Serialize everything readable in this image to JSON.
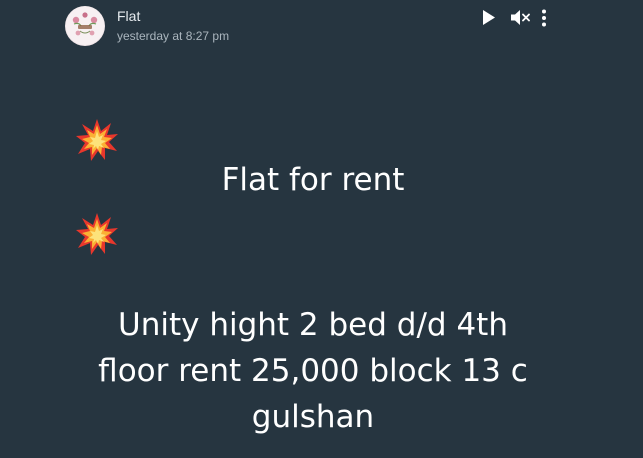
{
  "post": {
    "author": "Flat",
    "timestamp": "yesterday at 8:27 pm",
    "emoji_icon": "collision-emoji-icon",
    "headline": "Flat for rent",
    "body_lines": [
      "Unity hight 2 bed d/d 4th",
      "floor rent 25,000 block 13 c",
      "gulshan"
    ]
  },
  "controls": {
    "icons": [
      "play-icon",
      "mute-icon",
      "more-vertical-icon"
    ]
  },
  "colors": {
    "background": "#263540",
    "text": "#ffffff",
    "secondary_text": "#aab5bd"
  }
}
